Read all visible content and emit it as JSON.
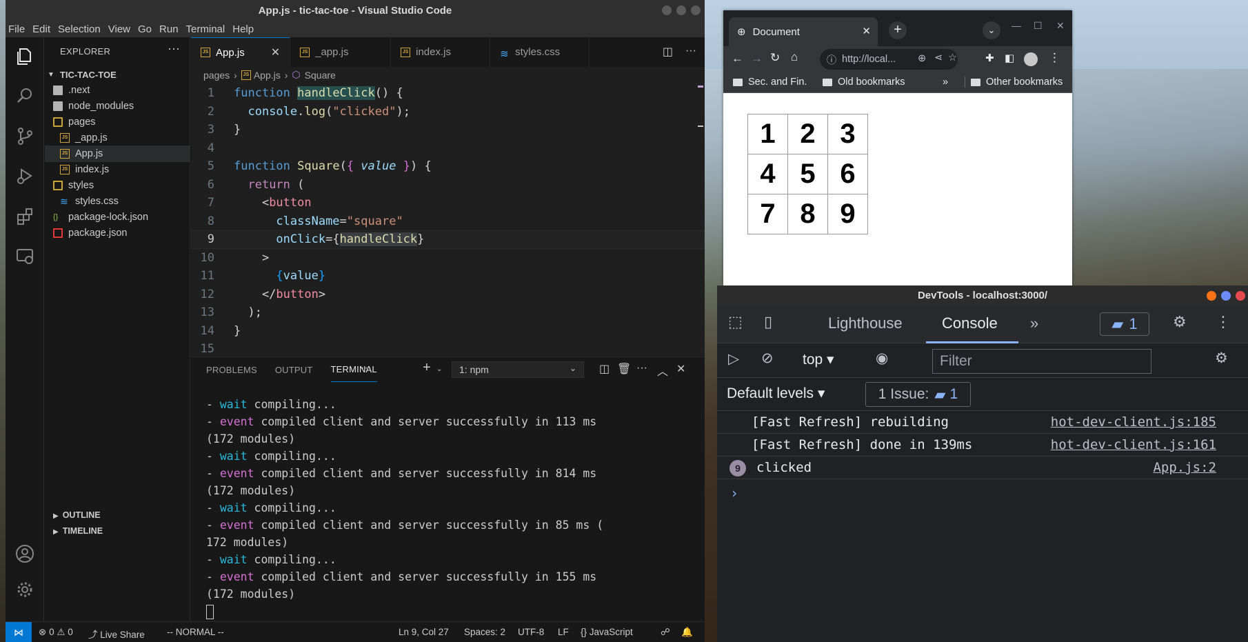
{
  "vscode": {
    "window_title": "App.js - tic-tac-toe - Visual Studio Code",
    "menu": [
      "File",
      "Edit",
      "Selection",
      "View",
      "Go",
      "Run",
      "Terminal",
      "Help"
    ],
    "explorer": {
      "title": "EXPLORER",
      "root": "TIC-TAC-TOE",
      "items": [
        ".next",
        "node_modules",
        "pages",
        "_app.js",
        "App.js",
        "index.js",
        "styles",
        "styles.css",
        "package-lock.json",
        "package.json"
      ],
      "outline": "OUTLINE",
      "timeline": "TIMELINE"
    },
    "tabs": [
      "App.js",
      "_app.js",
      "index.js",
      "styles.css"
    ],
    "breadcrumb": [
      "pages",
      "App.js",
      "Square"
    ],
    "code_lines": [
      "function handleClick() {",
      "  console.log(\"clicked\");",
      "}",
      "",
      "function Square({ value }) {",
      "  return (",
      "    <button",
      "      className=\"square\"",
      "      onClick={handleClick}",
      "    >",
      "      {value}",
      "    </button>",
      "  );",
      "}",
      ""
    ],
    "current_line": 9,
    "panel": {
      "tabs": [
        "PROBLEMS",
        "OUTPUT",
        "TERMINAL"
      ],
      "terminal_select": "1: npm",
      "terminal_lines": [
        {
          "prefix": "- ",
          "kw": "wait",
          "rest": " compiling..."
        },
        {
          "prefix": "- ",
          "kw": "event",
          "rest": " compiled client and server successfully in 113 ms (172 modules)"
        },
        {
          "prefix": "- ",
          "kw": "wait",
          "rest": " compiling..."
        },
        {
          "prefix": "- ",
          "kw": "event",
          "rest": " compiled client and server successfully in 814 ms (172 modules)"
        },
        {
          "prefix": "- ",
          "kw": "wait",
          "rest": " compiling..."
        },
        {
          "prefix": "- ",
          "kw": "event",
          "rest": " compiled client and server successfully in 85 ms (172 modules)"
        },
        {
          "prefix": "- ",
          "kw": "wait",
          "rest": " compiling..."
        },
        {
          "prefix": "- ",
          "kw": "event",
          "rest": " compiled client and server successfully in 155 ms (172 modules)"
        }
      ]
    },
    "status": {
      "errors": "0",
      "warnings": "0",
      "live_share": "Live Share",
      "mode": "-- NORMAL --",
      "position": "Ln 9, Col 27",
      "spaces": "Spaces: 2",
      "encoding": "UTF-8",
      "eol": "LF",
      "language": "JavaScript"
    }
  },
  "browser": {
    "tab_title": "Document",
    "url": "http://local...",
    "bookmarks": [
      "Sec. and Fin.",
      "Old bookmarks",
      "Other bookmarks"
    ],
    "board": [
      [
        "1",
        "2",
        "3"
      ],
      [
        "4",
        "5",
        "6"
      ],
      [
        "7",
        "8",
        "9"
      ]
    ]
  },
  "devtools": {
    "title": "DevTools - localhost:3000/",
    "tabs": [
      "Lighthouse",
      "Console"
    ],
    "badge_count": "1",
    "context": "top",
    "filter_placeholder": "Filter",
    "levels": "Default levels",
    "issues": "1 Issue:",
    "issues_count": "1",
    "messages": [
      {
        "text": "[Fast Refresh] rebuilding",
        "source": "hot-dev-client.js:185"
      },
      {
        "text": "[Fast Refresh] done in 139ms",
        "source": "hot-dev-client.js:161"
      },
      {
        "text": "clicked",
        "source": "App.js:2",
        "repeat": "9"
      }
    ]
  },
  "colors": {
    "accent": "#0078d4",
    "devtools_accent": "#8ab4f8",
    "terminal_wait": "#29b8db",
    "terminal_event": "#d670d6"
  }
}
